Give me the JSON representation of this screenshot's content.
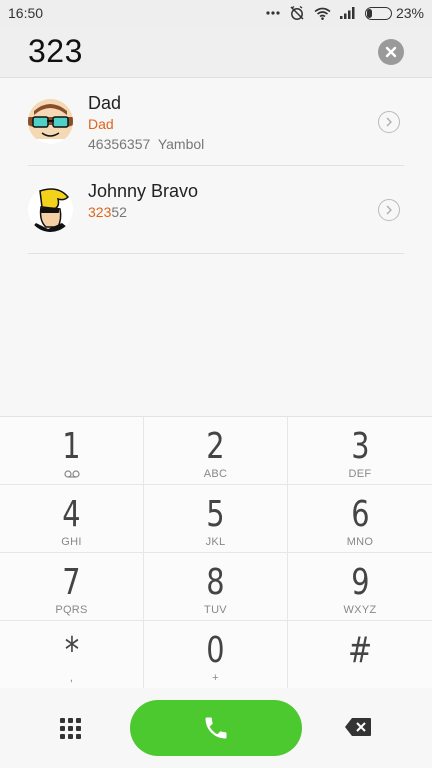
{
  "status_bar": {
    "time": "16:50",
    "battery_percent": "23%",
    "battery_level": 0.23,
    "icons": [
      "more-dots-icon",
      "alarm-off-icon",
      "wifi-icon",
      "signal-icon",
      "battery-icon"
    ]
  },
  "dialer": {
    "number": "323"
  },
  "contacts": [
    {
      "name": "Dad",
      "match_text": "Dad",
      "number": "46356357",
      "location": "Yambol"
    },
    {
      "name": "Johnny Bravo",
      "number_match": "323",
      "number_rest": "52"
    }
  ],
  "keypad": {
    "keys": [
      {
        "digit": "1",
        "letters": ""
      },
      {
        "digit": "2",
        "letters": "ABC"
      },
      {
        "digit": "3",
        "letters": "DEF"
      },
      {
        "digit": "4",
        "letters": "GHI"
      },
      {
        "digit": "5",
        "letters": "JKL"
      },
      {
        "digit": "6",
        "letters": "MNO"
      },
      {
        "digit": "7",
        "letters": "PQRS"
      },
      {
        "digit": "8",
        "letters": "TUV"
      },
      {
        "digit": "9",
        "letters": "WXYZ"
      },
      {
        "digit": "*",
        "letters": ","
      },
      {
        "digit": "0",
        "letters": "+"
      },
      {
        "digit": "#",
        "letters": ""
      }
    ]
  },
  "colors": {
    "accent_orange": "#e0651a",
    "call_green": "#4cc92f"
  }
}
